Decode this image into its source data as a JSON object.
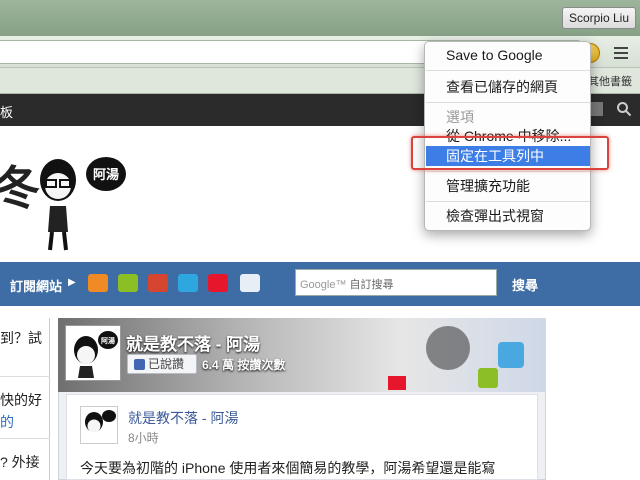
{
  "browser": {
    "profile_name": "Scorpio Liu",
    "bookmarks_other": "其他書籤",
    "menu": {
      "items": [
        {
          "label": "Save to Google"
        },
        {
          "label": "查看已儲存的網頁"
        },
        {
          "label": "選項"
        },
        {
          "label": "從 Chrome 中移除..."
        },
        {
          "label": "固定在工具列中"
        },
        {
          "label": "管理擴充功能"
        },
        {
          "label": "檢查彈出式視窗"
        }
      ]
    }
  },
  "site": {
    "nav_tail": "板",
    "header_letter": "冬",
    "mascot_badge": "阿湯",
    "subscribe_label": "訂閱網站",
    "search_logo": "Google™",
    "search_placeholder": "自訂搜尋",
    "search_button": "搜尋",
    "left_snippets": [
      "到？試",
      "快的好",
      "的",
      "? 外接"
    ]
  },
  "facebook": {
    "page_title": "就是教不落 - 阿湯",
    "like_button": "已說讚",
    "like_count": "6.4 萬 按讚次數",
    "avatar_badge": "阿湯",
    "post": {
      "author": "就是教不落 - 阿湯",
      "time": "8小時",
      "text": "今天要為初階的 iPhone 使用者來個簡易的教學，阿湯希望還是能寫"
    }
  },
  "colors": {
    "highlight": "#3d7ee6",
    "callout": "#d9443c",
    "site_blue": "#3d6da4",
    "fb_link": "#3b5998"
  },
  "icons": [
    "rss-icon",
    "android-icon",
    "google-plus-icon",
    "twitter-icon",
    "weibo-icon",
    "mail-icon",
    "extension-icon",
    "hamburger-menu-icon"
  ]
}
